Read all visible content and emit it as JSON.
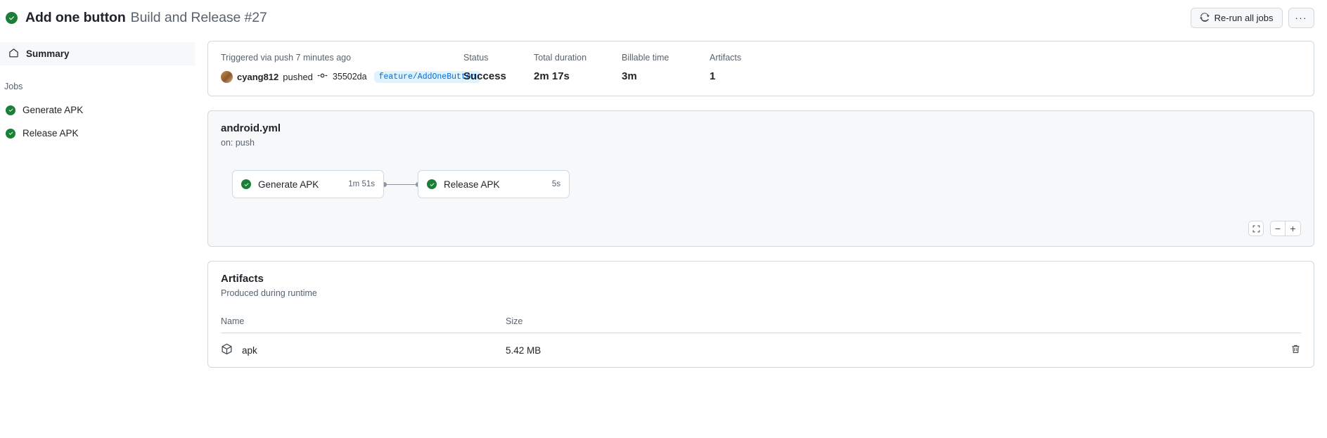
{
  "header": {
    "commit_title": "Add one button",
    "workflow_run": "Build and Release #27",
    "status_icon": "check-circle-icon",
    "rerun_label": "Re-run all jobs",
    "rerun_icon": "sync-icon",
    "overflow_label": "···"
  },
  "sidebar": {
    "summary_label": "Summary",
    "summary_icon": "home-icon",
    "jobs_heading": "Jobs",
    "jobs": [
      {
        "label": "Generate APK",
        "status_icon": "check-circle-icon"
      },
      {
        "label": "Release APK",
        "status_icon": "check-circle-icon"
      }
    ]
  },
  "summary": {
    "trigger_text": "Triggered via push 7 minutes ago",
    "actor": "cyang812",
    "pushed_text": "pushed",
    "commit_icon": "commit-icon",
    "sha": "35502da",
    "branch": "feature/AddOneButton",
    "stats": [
      {
        "label": "Status",
        "value": "Success"
      },
      {
        "label": "Total duration",
        "value": "2m 17s"
      },
      {
        "label": "Billable time",
        "value": "3m"
      },
      {
        "label": "Artifacts",
        "value": "1"
      }
    ]
  },
  "workflow": {
    "file_name": "android.yml",
    "trigger": "on: push",
    "nodes": [
      {
        "label": "Generate APK",
        "duration": "1m 51s",
        "status_icon": "check-circle-icon"
      },
      {
        "label": "Release APK",
        "duration": "5s",
        "status_icon": "check-circle-icon"
      }
    ],
    "controls": {
      "fullscreen_icon": "fullscreen-icon",
      "zoom_out_label": "−",
      "zoom_in_label": "+"
    }
  },
  "artifacts": {
    "title": "Artifacts",
    "subtitle": "Produced during runtime",
    "columns": {
      "name": "Name",
      "size": "Size"
    },
    "rows": [
      {
        "name": "apk",
        "size": "5.42 MB",
        "icon": "package-icon",
        "delete_icon": "trash-icon"
      }
    ]
  },
  "colors": {
    "success_green": "#1a7f37",
    "branch_blue": "#0969da",
    "branch_bg": "#ddf4ff",
    "border": "#d1d9e0",
    "muted_text": "#59636e"
  }
}
